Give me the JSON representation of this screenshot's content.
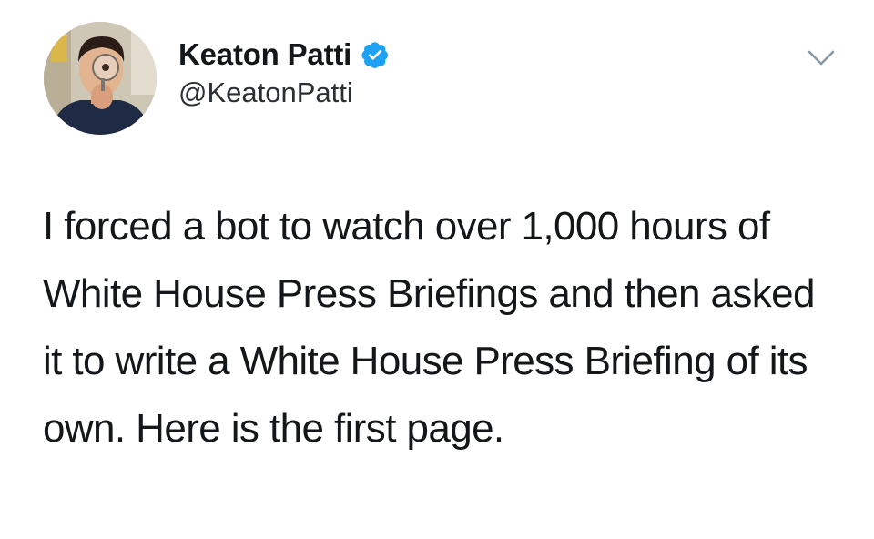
{
  "tweet": {
    "author": {
      "display_name": "Keaton Patti",
      "handle": "@KeatonPatti",
      "verified": true,
      "avatar_icon": "profile-photo"
    },
    "menu_icon": "chevron-down-icon",
    "text": "I forced a bot to watch over 1,000 hours of White House Press Briefings and then asked it to write a White House Press Briefing of its own. Here is the first page."
  },
  "colors": {
    "text": "#14171a",
    "verified_badge": "#1da1f2",
    "caret": "#8899a6",
    "background": "#ffffff"
  }
}
